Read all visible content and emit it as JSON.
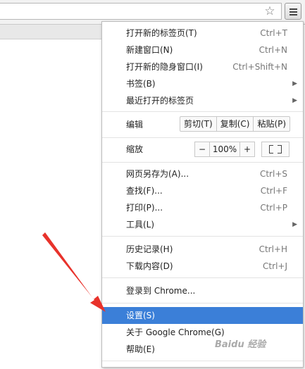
{
  "toolbar": {
    "star_icon": "star-icon",
    "menu_icon": "hamburger-menu-icon"
  },
  "menu": {
    "group1": [
      {
        "label": "打开新的标签页(T)",
        "shortcut": "Ctrl+T"
      },
      {
        "label": "新建窗口(N)",
        "shortcut": "Ctrl+N"
      },
      {
        "label": "打开新的隐身窗口(I)",
        "shortcut": "Ctrl+Shift+N"
      },
      {
        "label": "书签(B)",
        "shortcut": ""
      },
      {
        "label": "最近打开的标签页",
        "shortcut": ""
      }
    ],
    "edit": {
      "label": "编辑",
      "cut": "剪切(T)",
      "copy": "复制(C)",
      "paste": "粘贴(P)"
    },
    "zoom": {
      "label": "缩放",
      "minus": "−",
      "value": "100%",
      "plus": "+"
    },
    "group2": [
      {
        "label": "网页另存为(A)...",
        "shortcut": "Ctrl+S"
      },
      {
        "label": "查找(F)...",
        "shortcut": "Ctrl+F"
      },
      {
        "label": "打印(P)...",
        "shortcut": "Ctrl+P"
      },
      {
        "label": "工具(L)",
        "shortcut": ""
      }
    ],
    "group3": [
      {
        "label": "历史记录(H)",
        "shortcut": "Ctrl+H"
      },
      {
        "label": "下载内容(D)",
        "shortcut": "Ctrl+J"
      }
    ],
    "signin": {
      "label": "登录到 Chrome..."
    },
    "group4": [
      {
        "label": "设置(S)"
      },
      {
        "label": "关于 Google Chrome(G)"
      },
      {
        "label": "帮助(E)"
      }
    ]
  },
  "watermark": "Baidu 经验",
  "colors": {
    "selected": "#3b7fd8",
    "annotation_arrow": "#e8322b"
  }
}
